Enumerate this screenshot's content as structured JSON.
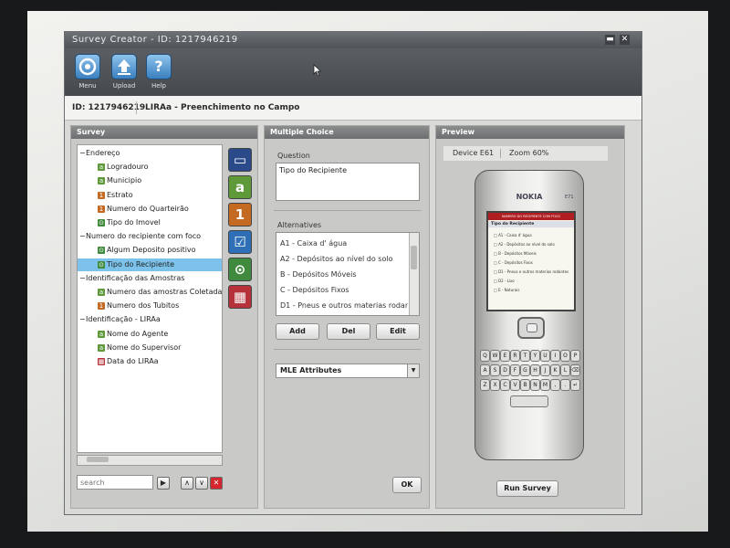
{
  "window": {
    "title": "Survey Creator - ID: 1217946219",
    "minimize_glyph": "▬",
    "close_glyph": "✕"
  },
  "toolbar": {
    "buttons": [
      {
        "label": "Menu",
        "icon": "menu-icon"
      },
      {
        "label": "Upload",
        "icon": "upload-icon"
      },
      {
        "label": "Help",
        "icon": "help-icon"
      }
    ]
  },
  "idbar": {
    "id_text": "ID: 1217946219",
    "survey_name": "LIRAa - Preenchimento no Campo"
  },
  "survey_panel": {
    "header": "Survey",
    "tree": [
      {
        "label": "Endereço",
        "type": "group"
      },
      {
        "label": "Logradouro",
        "type": "text"
      },
      {
        "label": "Municipio",
        "type": "text"
      },
      {
        "label": "Estrato",
        "type": "number"
      },
      {
        "label": "Numero do Quarteirão",
        "type": "number"
      },
      {
        "label": "Tipo do Imovel",
        "type": "choice"
      },
      {
        "label": "Numero do recipiente com foco",
        "type": "group"
      },
      {
        "label": "Algum Deposito positivo",
        "type": "choice"
      },
      {
        "label": "Tipo do Recipiente",
        "type": "choice",
        "selected": true
      },
      {
        "label": "Identificação das Amostras",
        "type": "group"
      },
      {
        "label": "Numero das amostras Coletadas",
        "type": "text"
      },
      {
        "label": "Numero dos Tubitos",
        "type": "number"
      },
      {
        "label": "Identificação - LIRAa",
        "type": "group"
      },
      {
        "label": "Nome do Agente",
        "type": "text"
      },
      {
        "label": "Nome do Supervisor",
        "type": "text"
      },
      {
        "label": "Data do LIRAa",
        "type": "date"
      }
    ],
    "palette": [
      {
        "name": "tile-screen",
        "glyph": "▭",
        "color": "#2b4a8a"
      },
      {
        "name": "tile-text",
        "glyph": "a",
        "color": "#5f9a3a"
      },
      {
        "name": "tile-number",
        "glyph": "1",
        "color": "#c46a22"
      },
      {
        "name": "tile-multiple-choice",
        "glyph": "☑",
        "color": "#2e6fb5"
      },
      {
        "name": "tile-single-choice",
        "glyph": "⊙",
        "color": "#3f8a3c"
      },
      {
        "name": "tile-date",
        "glyph": "▦",
        "color": "#b5323a"
      }
    ],
    "search": {
      "placeholder": "search"
    },
    "search_go_glyph": "▶",
    "move_up_glyph": "∧",
    "move_down_glyph": "∨",
    "delete_glyph": "✕"
  },
  "choice_panel": {
    "header": "Multiple Choice",
    "question_label": "Question",
    "question_value": "Tipo do Recipiente",
    "alternatives_label": "Alternatives",
    "alternatives": [
      "A1 - Caixa d' água",
      "A2 - Depósitos ao nível do solo",
      "B - Depósitos Móveis",
      "C - Depósitos Fixos",
      "D1 - Pneus e outros materias rodant..."
    ],
    "add_label": "Add",
    "del_label": "Del",
    "edit_label": "Edit",
    "mle_label": "MLE Attributes",
    "ok_label": "OK"
  },
  "preview_panel": {
    "header": "Preview",
    "device": "Device E61",
    "zoom": "Zoom 60%",
    "run_label": "Run Survey",
    "phone": {
      "brand": "NOKIA",
      "model": "E71",
      "screen_header": "NUMERO DO RECIPIENTE COM FOCO",
      "screen_title": "Tipo do Recipiente",
      "screen_items": [
        "A1 - Caixa d' água",
        "A2 - Depósitos ao nível do solo",
        "B - Depósitos Móveis",
        "C - Depósitos Fixos",
        "D1 - Pneus e outros materias rodantes",
        "D2 - Lixo",
        "E - Naturais"
      ],
      "keys": [
        [
          "Q",
          "W",
          "E",
          "R",
          "T",
          "Y",
          "U",
          "I",
          "O",
          "P"
        ],
        [
          "A",
          "S",
          "D",
          "F",
          "G",
          "H",
          "J",
          "K",
          "L",
          "⌫"
        ],
        [
          "Z",
          "X",
          "C",
          "V",
          "B",
          "N",
          "M",
          ",",
          ".",
          "↵"
        ]
      ]
    }
  }
}
